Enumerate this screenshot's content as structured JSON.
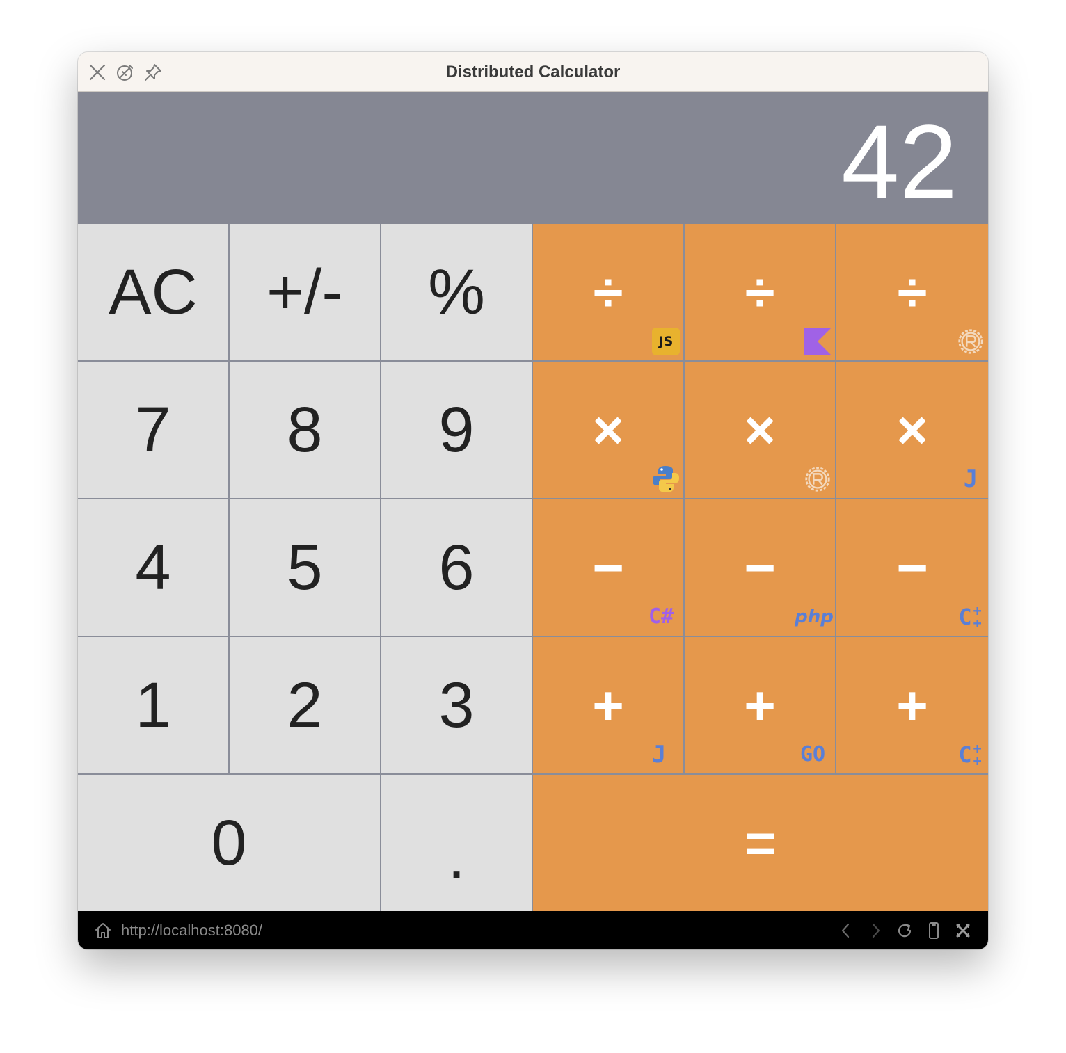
{
  "window": {
    "title": "Distributed Calculator"
  },
  "titlebar_icons": [
    "close-icon",
    "magic-icon",
    "pin-icon"
  ],
  "display": {
    "value": "42"
  },
  "keys": {
    "ac": "AC",
    "sign": "+/-",
    "percent": "%",
    "seven": "7",
    "eight": "8",
    "nine": "9",
    "four": "4",
    "five": "5",
    "six": "6",
    "one": "1",
    "two": "2",
    "three": "3",
    "zero": "0",
    "dot": ".",
    "divide": "÷",
    "multiply": "×",
    "subtract": "−",
    "add": "+",
    "equals": "="
  },
  "operator_services": {
    "divide": [
      "javascript-icon",
      "kotlin-icon",
      "rust-icon"
    ],
    "multiply": [
      "python-icon",
      "rust-icon",
      "java-icon"
    ],
    "subtract": [
      "csharp-icon",
      "php-icon",
      "cpp-icon"
    ],
    "add": [
      "java-icon",
      "go-icon",
      "cpp-icon"
    ]
  },
  "badge_text": {
    "js": "JS",
    "java": "J",
    "csharp": "C#",
    "php": "php",
    "go": "GO",
    "cpp": "C",
    "cpp_plus": "+"
  },
  "statusbar": {
    "url": "http://localhost:8080/"
  },
  "statusbar_icons": [
    "home-icon",
    "back-icon",
    "forward-icon",
    "reload-icon",
    "device-icon",
    "close-icon"
  ],
  "colors": {
    "display_bg": "#858793",
    "digit_key_bg": "#e0e0e0",
    "operator_key_bg": "#e5984c",
    "grid_line": "#8a8d99",
    "titlebar_bg": "#f8f4f0",
    "statusbar_bg": "#000000",
    "badge_blue": "#5a7fd6",
    "badge_purple": "#a060e8"
  }
}
